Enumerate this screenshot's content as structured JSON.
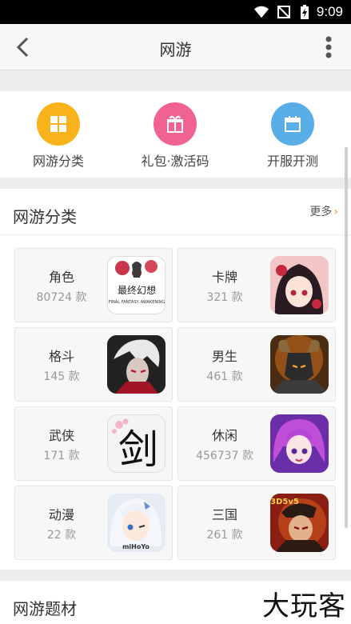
{
  "status_bar": {
    "time": "9:09"
  },
  "header": {
    "title": "网游"
  },
  "quick_nav": [
    {
      "label": "网游分类",
      "color": "#f8b31b",
      "icon": "grid-icon"
    },
    {
      "label": "礼包·激活码",
      "color": "#f06292",
      "icon": "gift-icon"
    },
    {
      "label": "开服开测",
      "color": "#5aaee8",
      "icon": "calendar-icon"
    }
  ],
  "category_section": {
    "title": "网游分类",
    "more_label": "更多",
    "items": [
      {
        "name": "角色",
        "count": "80724 款",
        "icon": "final-fantasy-icon",
        "logo_text": "最终幻想",
        "logo_sub": "FINAL FANTASY. AWAKENING"
      },
      {
        "name": "卡牌",
        "count": "321 款",
        "icon": "anime-girl-icon"
      },
      {
        "name": "格斗",
        "count": "145 款",
        "icon": "white-hair-fighter-icon"
      },
      {
        "name": "男生",
        "count": "461 款",
        "icon": "armored-warrior-icon"
      },
      {
        "name": "武侠",
        "count": "171 款",
        "icon": "sword-calligraphy-icon",
        "logo_text": "剑"
      },
      {
        "name": "休闲",
        "count": "456737 款",
        "icon": "purple-hair-girl-icon"
      },
      {
        "name": "动漫",
        "count": "22 款",
        "icon": "honkai-girl-icon",
        "logo_text": "miHoYo"
      },
      {
        "name": "三国",
        "count": "261 款",
        "icon": "three-kingdoms-hero-icon",
        "logo_text": "3D5v5"
      }
    ]
  },
  "next_section": {
    "title": "网游题材"
  },
  "watermark": "大玩客"
}
